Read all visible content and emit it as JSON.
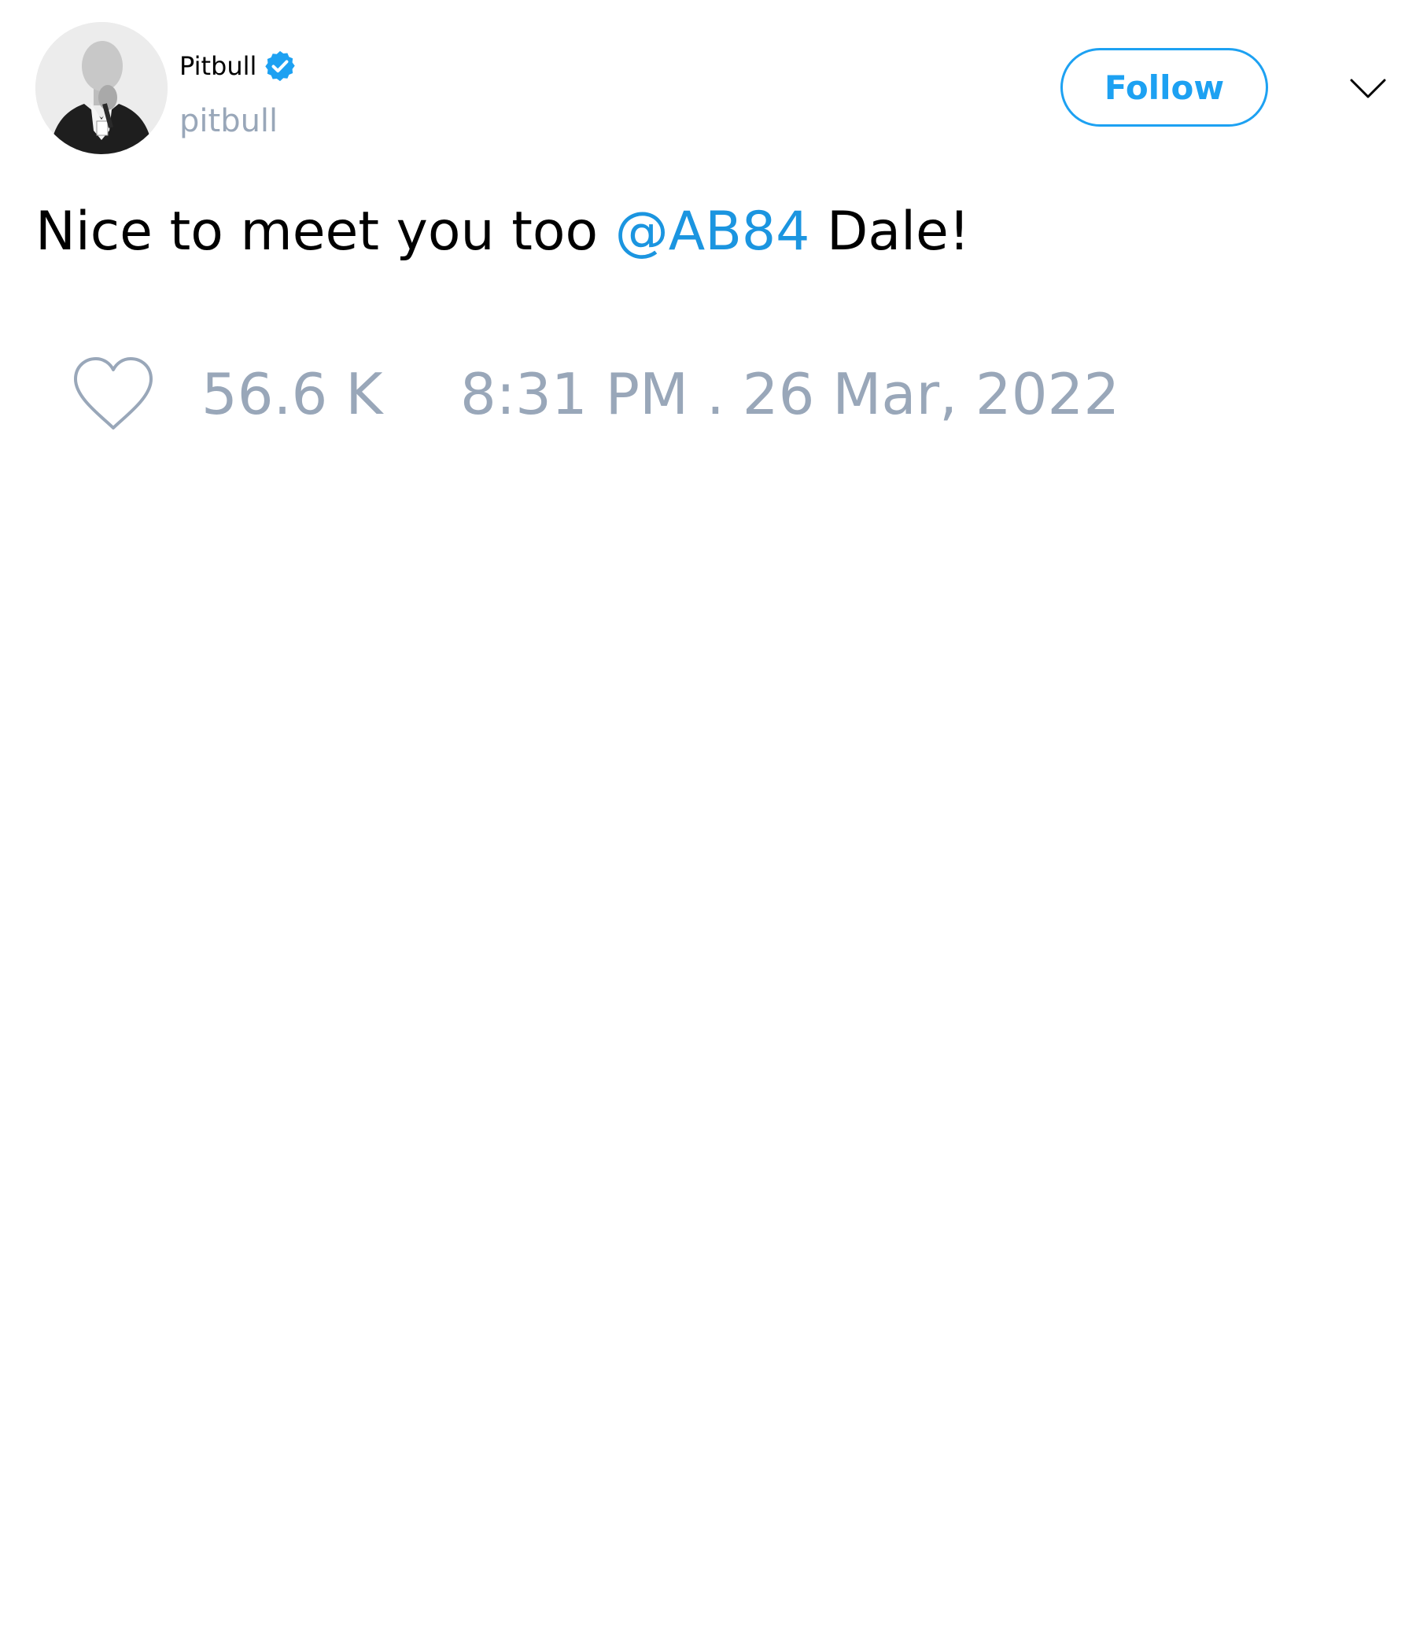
{
  "author": {
    "display_name": "Pitbull",
    "handle": "pitbull",
    "verified": true,
    "avatar_icon": "profile-photo"
  },
  "actions": {
    "follow_label": "Follow",
    "menu_icon": "chevron-down-icon"
  },
  "tweet": {
    "text_before": "Nice to meet you too ",
    "mention": "@AB84",
    "text_after": " Dale!"
  },
  "footer": {
    "like_icon": "heart-icon",
    "like_count": "56.6 K",
    "timestamp": "8:31 PM . 26 Mar, 2022"
  },
  "colors": {
    "accent": "#1da1f2",
    "mention": "#1b95e0",
    "muted": "#99a7b9",
    "text": "#000000"
  }
}
